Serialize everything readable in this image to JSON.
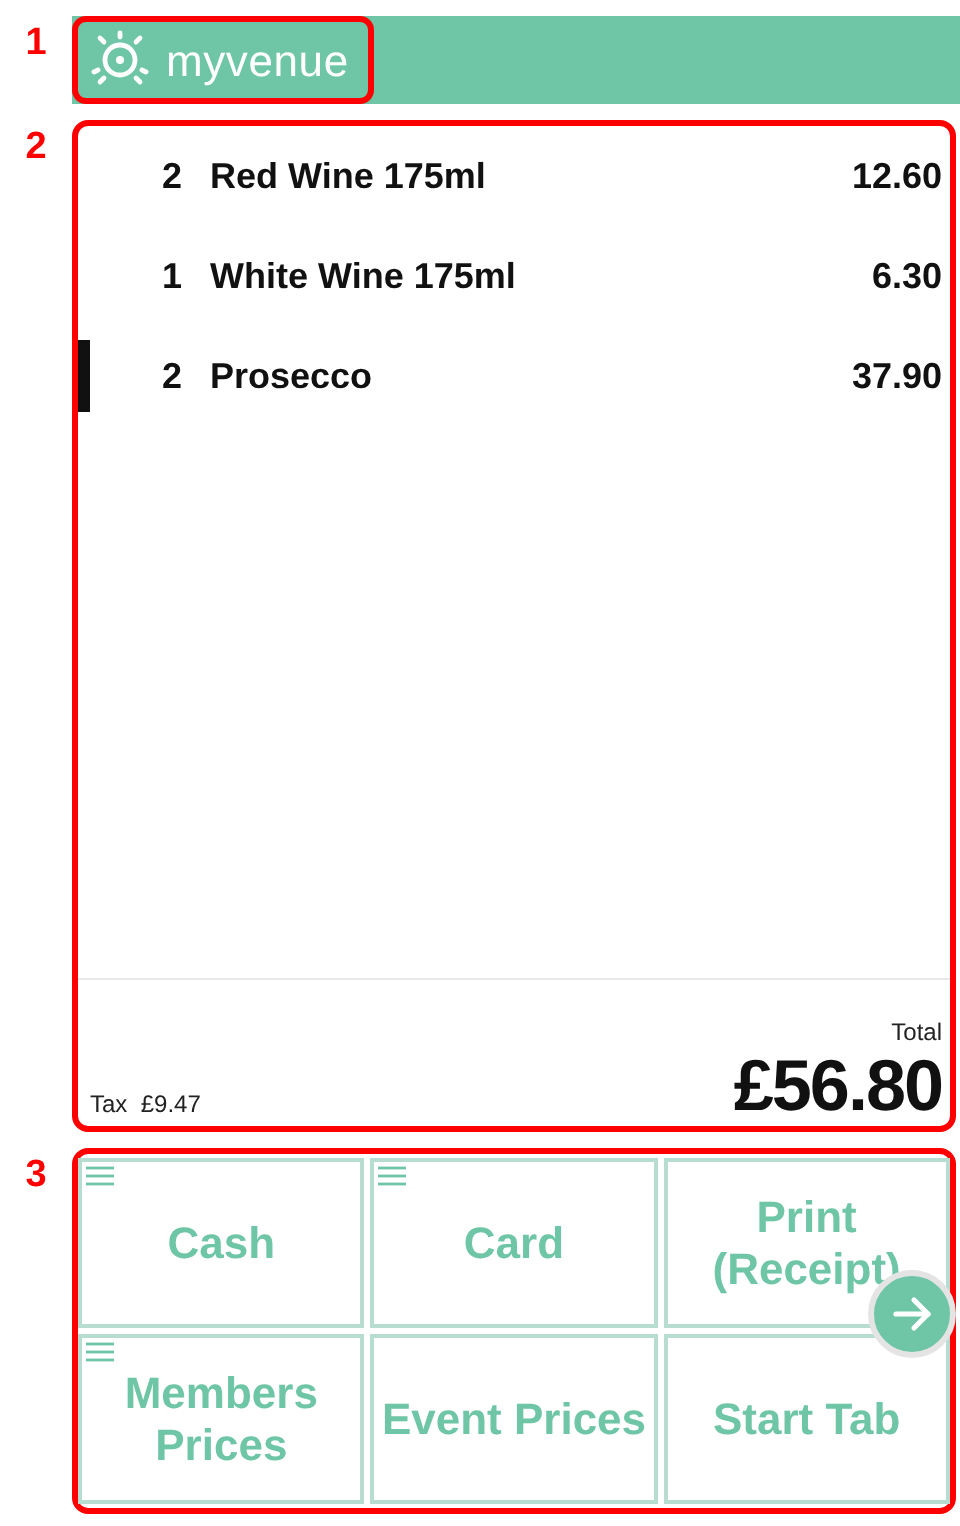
{
  "header": {
    "brand": "myvenue",
    "callout": "1"
  },
  "order": {
    "callout": "2",
    "items": [
      {
        "qty": "2",
        "name": "Red Wine 175ml",
        "price": "12.60",
        "selected": false
      },
      {
        "qty": "1",
        "name": "White Wine 175ml",
        "price": "6.30",
        "selected": false
      },
      {
        "qty": "2",
        "name": "Prosecco",
        "price": "37.90",
        "selected": true
      }
    ],
    "tax_label": "Tax",
    "tax": "£9.47",
    "total_label": "Total",
    "total": "£56.80"
  },
  "actions": {
    "callout": "3",
    "buttons": [
      {
        "label": "Cash",
        "menu": true
      },
      {
        "label": "Card",
        "menu": true
      },
      {
        "label": "Print (Receipt)",
        "menu": false
      },
      {
        "label": "Members Prices",
        "menu": true
      },
      {
        "label": "Event Prices",
        "menu": false
      },
      {
        "label": "Start Tab",
        "menu": false
      }
    ]
  }
}
